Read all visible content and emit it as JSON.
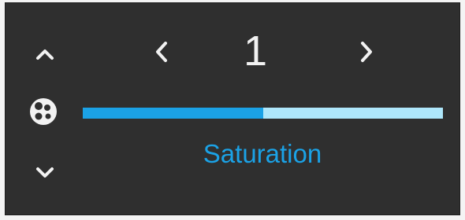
{
  "control": {
    "page_number": "1",
    "mode_label": "Saturation",
    "saturation_level": 0.5,
    "icons": {
      "up": "chevron-up-icon",
      "down": "chevron-down-icon",
      "prev": "chevron-left-icon",
      "next": "chevron-right-icon",
      "mode": "palette-icon"
    }
  },
  "colors": {
    "panel_background": "#2f2f2f",
    "icon": "#f2f2f2",
    "accent": "#1ba2e6",
    "track": "#aee7fb"
  }
}
